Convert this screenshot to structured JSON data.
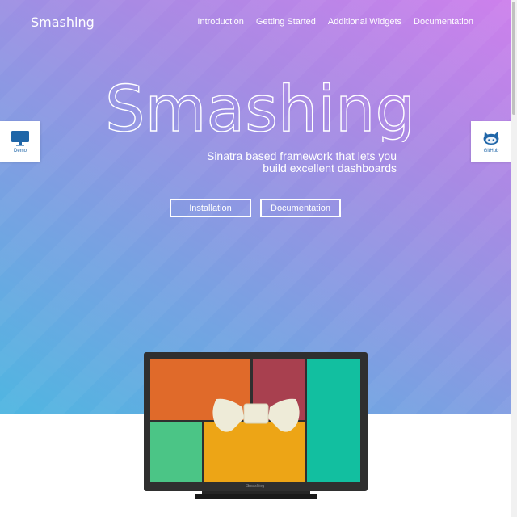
{
  "header": {
    "brand": "Smashing",
    "nav": [
      {
        "label": "Introduction"
      },
      {
        "label": "Getting Started"
      },
      {
        "label": "Additional Widgets"
      },
      {
        "label": "Documentation"
      }
    ]
  },
  "hero": {
    "title": "Smashing",
    "tagline_line1": "Sinatra based framework that lets you",
    "tagline_line2": "build excellent dashboards",
    "buttons": {
      "installation": "Installation",
      "documentation": "Documentation"
    }
  },
  "side_tabs": {
    "demo": {
      "label": "Demo",
      "icon": "monitor-icon"
    },
    "github": {
      "label": "GitHub",
      "icon": "octocat-icon"
    }
  },
  "monitor": {
    "brand_label": "Smashing"
  },
  "colors": {
    "gradient_top_right": "#cd80ec",
    "gradient_bottom_left": "#4fb6e1",
    "tile_orange": "#e06a2a",
    "tile_red": "#a8404f",
    "tile_teal": "#12bfa0",
    "tile_green": "#4bc586",
    "tile_yellow": "#eda516",
    "bow": "#eeebd8",
    "link_blue": "#1f66a8"
  }
}
